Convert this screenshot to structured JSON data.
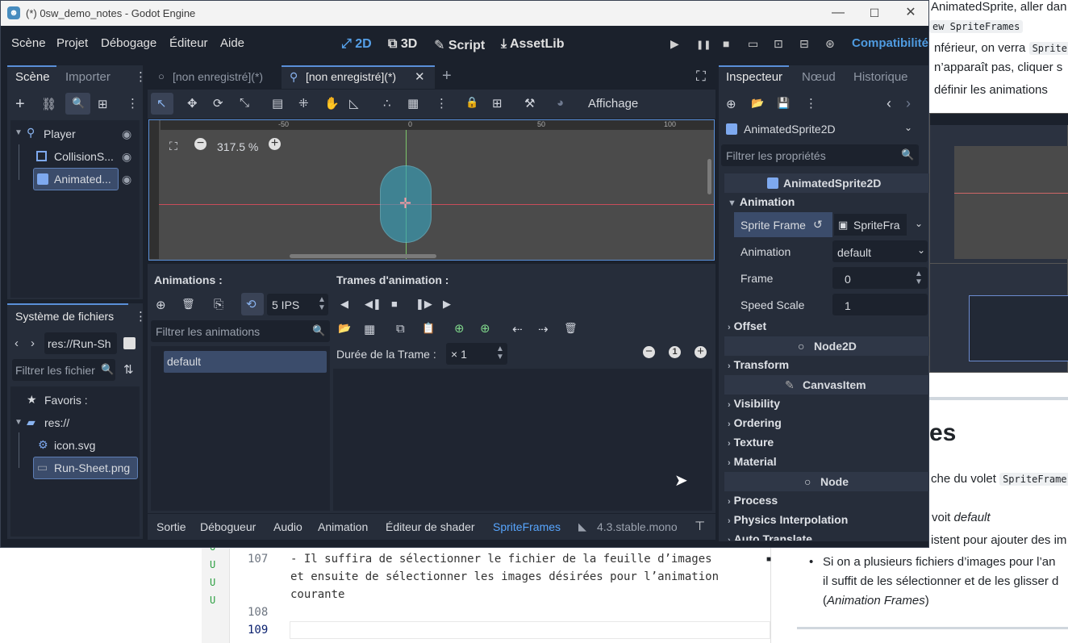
{
  "window": {
    "title": "(*) 0sw_demo_notes - Godot Engine",
    "logo_glyph": "☻",
    "min_glyph": "—",
    "max_glyph": "☐",
    "close_glyph": "✕"
  },
  "menu": [
    "Scène",
    "Projet",
    "Débogage",
    "Éditeur",
    "Aide"
  ],
  "modes": [
    {
      "glyph": "⤢",
      "label": "2D"
    },
    {
      "glyph": "⧉",
      "label": "3D"
    },
    {
      "glyph": "✎",
      "label": "Script"
    },
    {
      "glyph": "⤓",
      "label": "AssetLib"
    }
  ],
  "play_glyphs": [
    "▶",
    "❚❚",
    "■",
    "▭",
    "⊡",
    "⊟",
    "⊛"
  ],
  "renderer": "Compatibilité",
  "scene_dock": {
    "tab_scene": "Scène",
    "tab_import": "Importer",
    "tools": [
      "+",
      "⛓",
      "🔍",
      "⊞",
      "⋮"
    ],
    "tree": [
      {
        "label": "Player"
      },
      {
        "label": "CollisionS..."
      },
      {
        "label": "Animated..."
      }
    ],
    "eye_glyph": "◉"
  },
  "filesystem": {
    "title": "Système de fichiers",
    "path": "res://Run-Sh",
    "filter_placeholder": "Filtrer les fichier",
    "items": [
      {
        "icon": "★",
        "label": "Favoris :"
      },
      {
        "icon": "▰",
        "label": "res://"
      },
      {
        "icon": "⚙",
        "label": "icon.svg"
      },
      {
        "icon": "▭",
        "label": "Run-Sheet.png"
      }
    ]
  },
  "editor_tabs": [
    {
      "label": "[non enregistré](*)"
    },
    {
      "label": "[non enregistré](*)"
    }
  ],
  "viewport_toolbar": {
    "tools": [
      "↖",
      "✥",
      "⟳",
      "⤡",
      "▤",
      "⁜",
      "✋",
      "◺",
      "∴",
      "▦",
      "⋮",
      "🔒",
      "⊞",
      "⚒",
      "◕"
    ],
    "view_label": "Affichage"
  },
  "viewport": {
    "zoom": "317.5 %",
    "ruler_ticks": [
      "-50",
      "0",
      "50",
      "100"
    ],
    "zoom_out": "−",
    "zoom_in": "+",
    "center_glyph": "✛"
  },
  "animations_panel": {
    "title": "Animations :",
    "frames_title": "Trames d'animation :",
    "fps": "5 IPS",
    "filter_placeholder": "Filtrer les animations",
    "animations": [
      "default"
    ],
    "frame_duration_label": "Durée de la Trame :",
    "frame_duration": "× 1",
    "anim_tools": [
      "⊕",
      "🗑",
      "⎘",
      "⟲"
    ],
    "play_tools": [
      "◀",
      "◀❚",
      "■",
      "❚▶",
      "▶"
    ],
    "frame_tools": [
      "📂",
      "▦",
      "⧉",
      "📋",
      "⊕",
      "⊕",
      "⇠",
      "⇢",
      "🗑"
    ],
    "zoom_tools": [
      "−",
      "1",
      "+"
    ]
  },
  "bottom_tabs": [
    "Sortie",
    "Débogueur",
    "Audio",
    "Animation",
    "Éditeur de shader",
    "SpriteFrames"
  ],
  "version": "4.3.stable.mono",
  "inspector": {
    "tabs": [
      "Inspecteur",
      "Nœud",
      "Historique"
    ],
    "tools": [
      "⊕",
      "📂",
      "💾",
      "⋮"
    ],
    "node": "AnimatedSprite2D",
    "filter_placeholder": "Filtrer les propriétés",
    "class_header": "AnimatedSprite2D",
    "group_animation": "Animation",
    "props": [
      {
        "label": "Sprite Frame",
        "value": "SpriteFra"
      },
      {
        "label": "Animation",
        "value": "default"
      },
      {
        "label": "Frame",
        "value": "0"
      },
      {
        "label": "Speed Scale",
        "value": "1"
      }
    ],
    "sections": [
      "Offset",
      "Node2D",
      "Transform",
      "CanvasItem",
      "Visibility",
      "Ordering",
      "Texture",
      "Material",
      "Node",
      "Process",
      "Physics Interpolation",
      "Auto Translate"
    ]
  },
  "code_editor": {
    "line_numbers": [
      "107",
      "108",
      "109"
    ],
    "lines": [
      "- Il suffira de sélectionner le fichier de la feuille d’images",
      "et ensuite de sélectionner les images désirées pour l’animation",
      "courante"
    ],
    "git_marks": [
      "U",
      "U",
      "U",
      "U"
    ]
  },
  "preview": {
    "p1": "AnimatedSprite, aller dan",
    "p1_code": "ew SpriteFrames",
    "p2": "nférieur, on verra",
    "p2_code": "Sprite",
    "p3": "n’apparaît pas, cliquer s",
    "p4": "définir les animations",
    "heading": "es",
    "p5": "che du volet",
    "p5_code": "SpriteFrame",
    "p6": "voit",
    "p6_em": "default",
    "p7": "istent pour ajouter des im",
    "bullet1": "Si on a plusieurs fichiers d’images pour l’an",
    "bullet2": "il suffit de les sélectionner et de les glisser d",
    "bullet3": "Animation Frames"
  }
}
